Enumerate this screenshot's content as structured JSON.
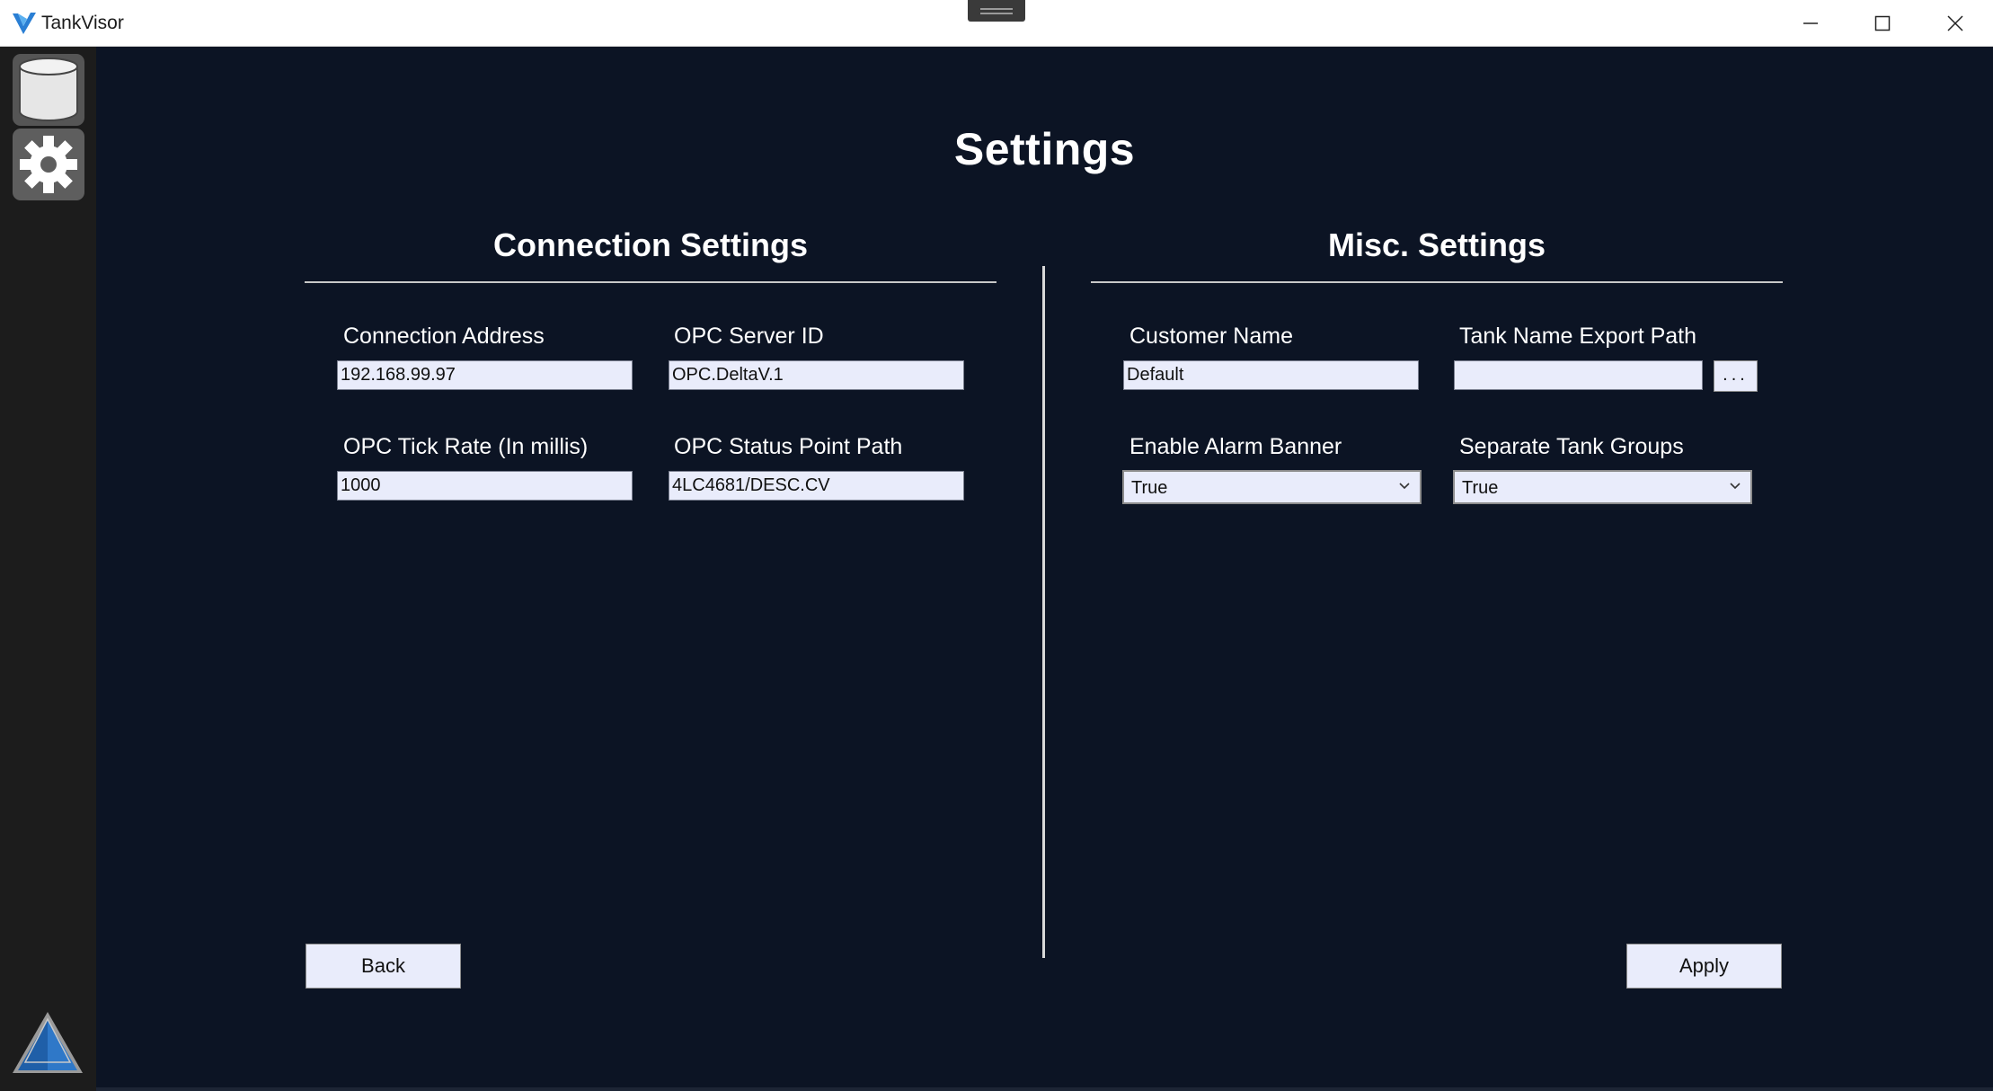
{
  "window": {
    "title": "TankVisor"
  },
  "sidebar": {
    "items": [
      {
        "icon": "database-icon",
        "label": ""
      },
      {
        "icon": "gear-icon",
        "label": ""
      }
    ]
  },
  "page": {
    "title": "Settings"
  },
  "connection": {
    "heading": "Connection Settings",
    "connection_address_label": "Connection Address",
    "connection_address_value": "192.168.99.97",
    "opc_server_id_label": "OPC Server ID",
    "opc_server_id_value": "OPC.DeltaV.1",
    "tick_rate_label": "OPC Tick Rate (In millis)",
    "tick_rate_value": "1000",
    "status_point_label": "OPC Status Point Path",
    "status_point_value": "4LC4681/DESC.CV"
  },
  "misc": {
    "heading": "Misc. Settings",
    "customer_name_label": "Customer Name",
    "customer_name_value": "Default",
    "export_path_label": "Tank Name Export Path",
    "export_path_value": "",
    "browse_label": "...",
    "alarm_banner_label": "Enable Alarm Banner",
    "alarm_banner_value": "True",
    "separate_groups_label": "Separate Tank Groups",
    "separate_groups_value": "True"
  },
  "actions": {
    "back_label": "Back",
    "apply_label": "Apply"
  },
  "colors": {
    "background": "#0c1424",
    "sidebar": "#1c1c1c",
    "input": "#e9ecfb"
  }
}
